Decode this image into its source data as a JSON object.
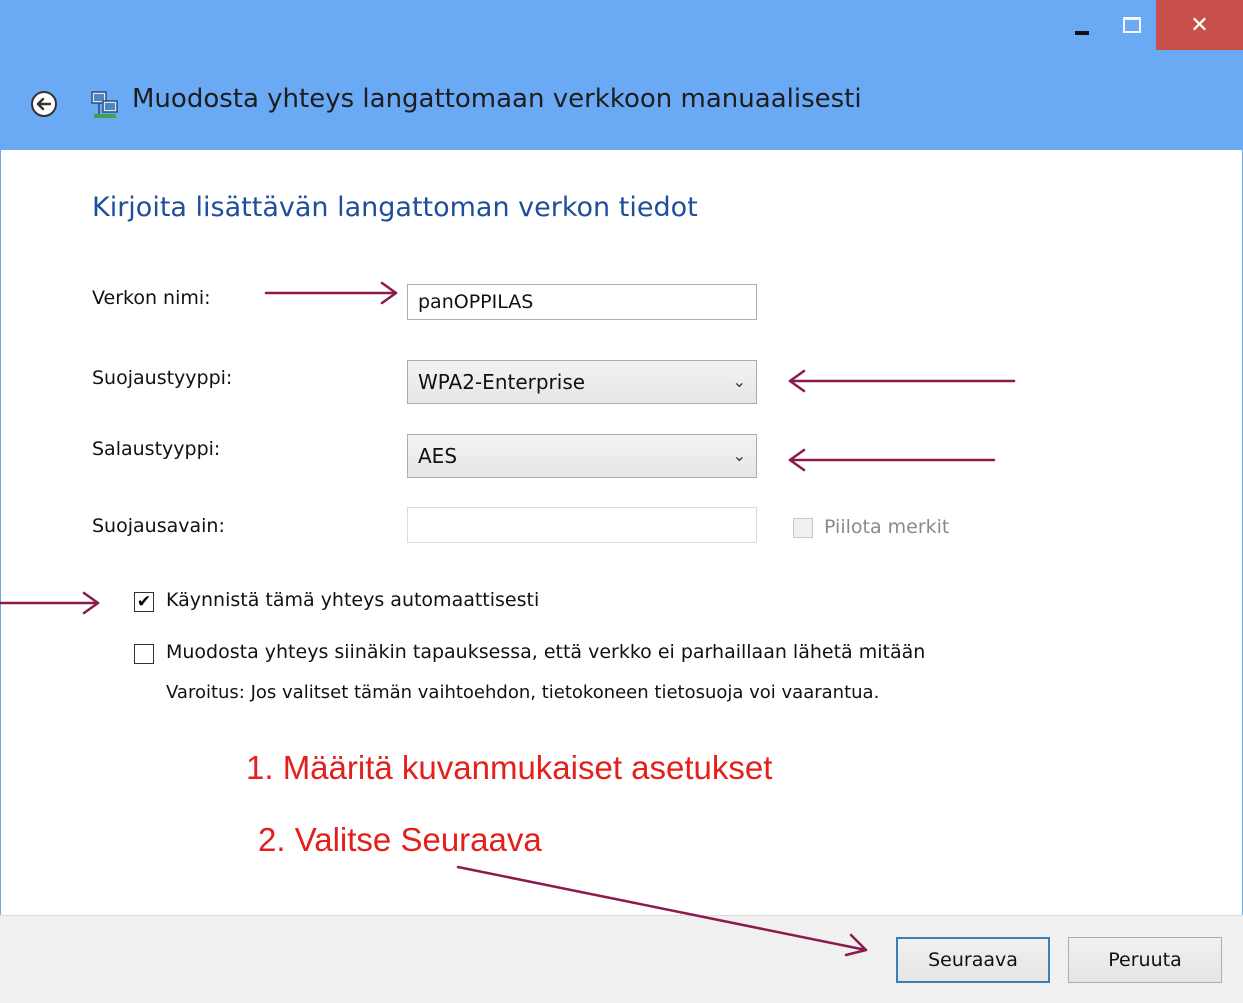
{
  "window": {
    "title": "Muodosta yhteys langattomaan verkkoon manuaalisesti",
    "close_glyph": "✕",
    "titlebar_color": "#6aaaf5",
    "close_color": "#c7504a"
  },
  "main": {
    "heading": "Kirjoita lisättävän langattoman verkon tiedot",
    "network_name": {
      "label": "Verkon nimi:",
      "value": "panOPPILAS"
    },
    "security_type": {
      "label": "Suojaustyyppi:",
      "value": "WPA2-Enterprise"
    },
    "encryption_type": {
      "label": "Salaustyyppi:",
      "value": "AES"
    },
    "security_key": {
      "label": "Suojausavain:",
      "value": "",
      "hide_chars_label": "Piilota merkit",
      "hide_chars_checked": false
    },
    "auto_start": {
      "label": "Käynnistä tämä yhteys automaattisesti",
      "checked": true
    },
    "connect_hidden": {
      "label": "Muodosta yhteys siinäkin tapauksessa, että verkko ei parhaillaan lähetä mitään",
      "checked": false
    },
    "warning": "Varoitus: Jos valitset tämän vaihtoehdon, tietokoneen tietosuoja voi vaarantua."
  },
  "annotations": {
    "step1": "1.  Määritä kuvanmukaiset asetukset",
    "step2": "2. Valitse Seuraava",
    "text_color": "#e3201b",
    "arrow_color": "#8b1a4e"
  },
  "footer": {
    "next_label": "Seuraava",
    "cancel_label": "Peruuta"
  },
  "icons": [
    "back-arrow-icon",
    "network-icon",
    "minimize-icon",
    "maximize-icon",
    "close-icon",
    "chevron-down-icon",
    "checkmark-icon"
  ]
}
